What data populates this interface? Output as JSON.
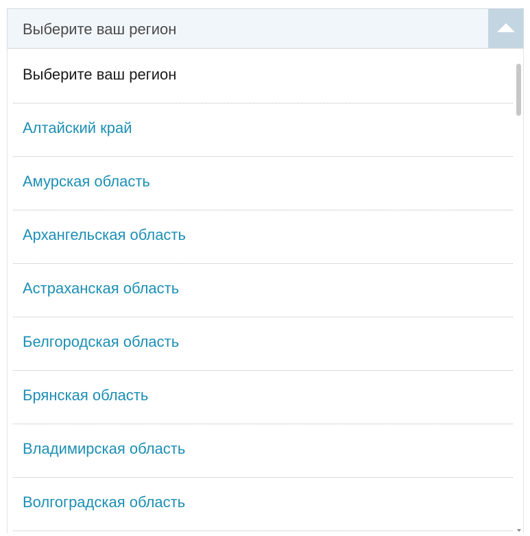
{
  "select": {
    "value": "Выберите ваш регион",
    "toggle_icon": "triangle-up-icon"
  },
  "options": [
    {
      "label": "Выберите ваш регион",
      "placeholder": true
    },
    {
      "label": "Алтайский край"
    },
    {
      "label": "Амурская область"
    },
    {
      "label": "Архангельская область"
    },
    {
      "label": "Астраханская область"
    },
    {
      "label": "Белгородская область"
    },
    {
      "label": "Брянская область"
    },
    {
      "label": "Владимирская область"
    },
    {
      "label": "Волгоградская область"
    }
  ],
  "colors": {
    "option_text": "#1d8fb4",
    "placeholder_text": "#1a1a1a",
    "header_bg": "#f1f6fa",
    "arrow_bg": "#c4d5e2"
  }
}
